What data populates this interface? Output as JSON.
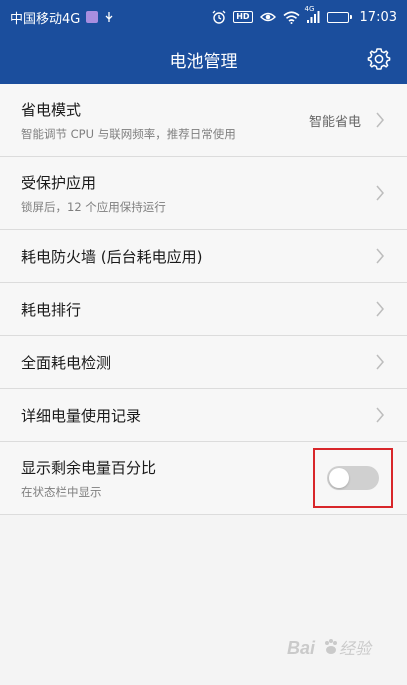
{
  "status_bar": {
    "carrier": "中国移动4G",
    "time": "17:03",
    "network": "4G",
    "icons": [
      "carrier-app-badge-icon",
      "usb-icon",
      "alarm-icon",
      "hd-icon",
      "eye-icon",
      "wifi-icon",
      "cell-signal-icon",
      "battery-icon"
    ],
    "hd_label": "HD"
  },
  "header": {
    "title": "电池管理",
    "settings_icon": "gear-icon"
  },
  "list": [
    {
      "title": "省电模式",
      "subtitle": "智能调节 CPU 与联网频率，推荐日常使用",
      "value": "智能省电"
    },
    {
      "title": "受保护应用",
      "subtitle": "锁屏后，12 个应用保持运行"
    },
    {
      "title": "耗电防火墙 (后台耗电应用)"
    },
    {
      "title": "耗电排行"
    },
    {
      "title": "全面耗电检测"
    },
    {
      "title": "详细电量使用记录"
    }
  ],
  "toggle_row": {
    "title": "显示剩余电量百分比",
    "subtitle": "在状态栏中显示",
    "enabled": false
  },
  "colors": {
    "header_bg": "#1b4e9d",
    "highlight_border": "#d8262a",
    "toggle_off": "#d0d0d0"
  }
}
